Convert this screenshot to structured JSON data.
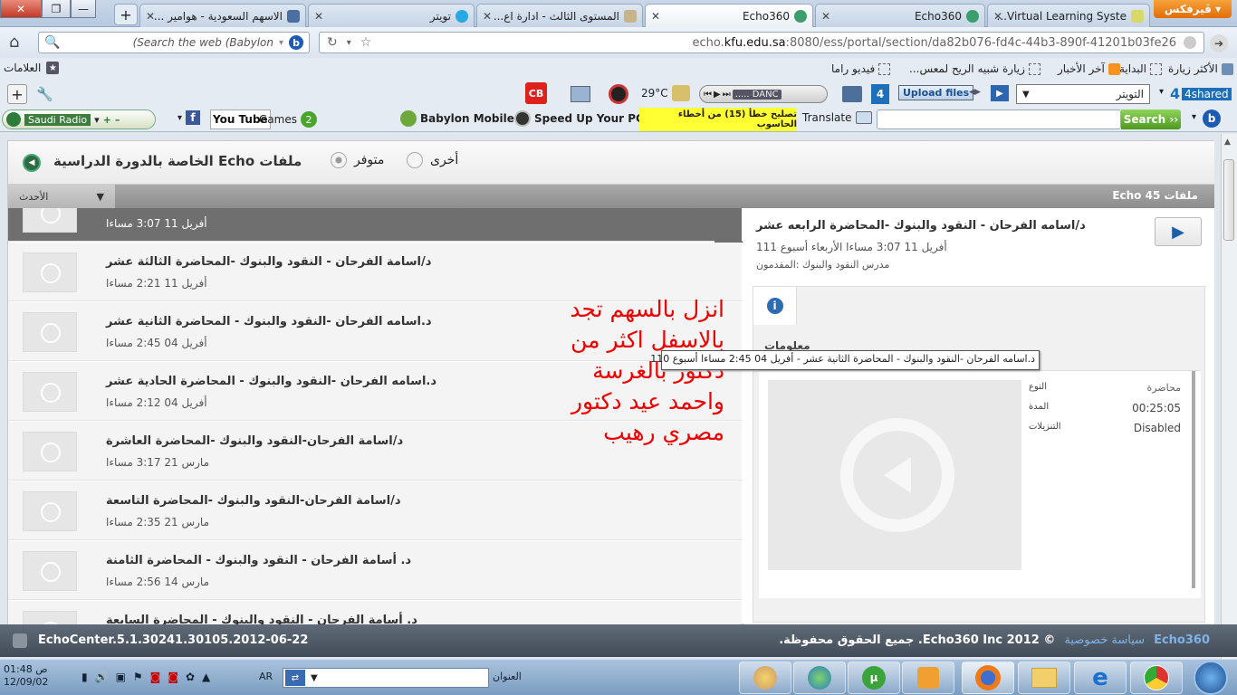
{
  "tabs": [
    {
      "label": "Virtual Learning Syste...",
      "active": false
    },
    {
      "label": "Echo360",
      "active": false
    },
    {
      "label": "Echo360",
      "active": true
    },
    {
      "label": "المستوى الثالث - ادارة اع...",
      "active": false
    },
    {
      "label": "تويتر",
      "active": false
    },
    {
      "label": "الاسهم السعودية - هوامير ...",
      "active": false
    }
  ],
  "firefox_label": "فَيرفكس",
  "nav": {
    "url_prefix": "echo.",
    "url_domain": "kfu.edu.sa",
    "url_rest": ":8080/ess/portal/section/da82b076-fd4c-44b3-890f-41201b03fe26",
    "search_placeholder": "(Search the web (Babylon"
  },
  "bookmarks": {
    "most_visited": "الأكثر زيارة",
    "start": "البداية",
    "latest_news": "آخر الأخبار",
    "wind_visit": "زيارة شبيه الريح لمعس...",
    "video_rama": "فيديو راما",
    "bookmarks_menu": "العلامات"
  },
  "toolbar1": {
    "twitter_select": "التويتر",
    "shared": "4shared",
    "upload_files": "Upload files",
    "dance_text": "..... DANC",
    "temperature": "29°C",
    "cb": "CB"
  },
  "toolbar2": {
    "search_button": "Search",
    "translate": "Translate",
    "fix_errors": "تصليح خطأ (15) من أخطاء الحاسوب",
    "speed_up": "Speed Up Your PC",
    "babylon_mobile": "Babylon Mobile",
    "games": "Games",
    "youtube": "You Tube",
    "saudi_radio": "Saudi Radio"
  },
  "page": {
    "header_title": "ملفات Echo الخاصة بالدورة الدراسية",
    "filter_available": "متوفر",
    "filter_other": "أخرى",
    "sort_label": "الأحدث",
    "count_label": "Echo 45 ملفات",
    "items": [
      {
        "title": "",
        "date": "أفريل 11  3:07 مساءا",
        "selected": true
      },
      {
        "title": "د/اسامة الفرحان - النقود والبنوك -المحاضرة الثالثة عشر",
        "date": "أفريل 11  2:21 مساءا",
        "selected": false
      },
      {
        "title": "د.اسامه الفرحان -النقود والبنوك - المحاضرة الثانية عشر",
        "date": "أفريل 04  2:45 مساءا",
        "selected": false
      },
      {
        "title": "د.اسامه الفرحان -النقود والبنوك - المحاضرة الحادية عشر",
        "date": "أفريل 04  2:12 مساءا",
        "selected": false
      },
      {
        "title": "د/اسامة الفرحان-النقود والبنوك -المحاضرة العاشرة",
        "date": "مارس 21  3:17 مساءا",
        "selected": false
      },
      {
        "title": "د/اسامة الفرحان-النقود والبنوك -المحاضرة التاسعة",
        "date": "مارس 21  2:35 مساءا",
        "selected": false
      },
      {
        "title": "د. أسامة الفرحان - النقود والبنوك - المحاضرة الثامنة",
        "date": "مارس 14  2:56 مساءا",
        "selected": false
      },
      {
        "title": "د. أسامة الفرحان - النقود والبنوك - المحاضرة السابعة",
        "date": "",
        "selected": false
      }
    ],
    "detail": {
      "title": "د/اسامه الفرحان - النقود والبنوك -المحاضرة الرابعه عشر",
      "date_line": "أفريل 11  3:07 مساءا الأربعاء أسبوع 111",
      "instructor_line": "مدرس النقود والبنوك :المقدمون",
      "info_heading": "معلومات",
      "type_label": "النوع",
      "type_value": "محاضرة",
      "duration_label": "المدة",
      "duration_value": "00:25:05",
      "downloads_label": "التنزيلات",
      "downloads_value": "Disabled"
    },
    "tooltip": "د.اسامه الفرحان -النقود والبنوك - المحاضرة الثانية عشر - أفريل 04  2:45 مساءا أسبوع 110",
    "note": "انزل بالسهم تجد بالاسفل اكثر من دكتور بالغرسة واحمد عيد دكتور مصري رهيب"
  },
  "statusbar": {
    "version": "EchoCenter.5.1.30241.30105.2012-06-22",
    "copyright": "© 2012 Echo360 Inc. جميع الحقوق محفوظة.",
    "privacy": "سياسة خصوصية",
    "brand": "Echo360"
  },
  "taskbar": {
    "time": "01:48 ص",
    "date": "12/09/02",
    "lang": "AR",
    "address_label": "العنوان"
  }
}
